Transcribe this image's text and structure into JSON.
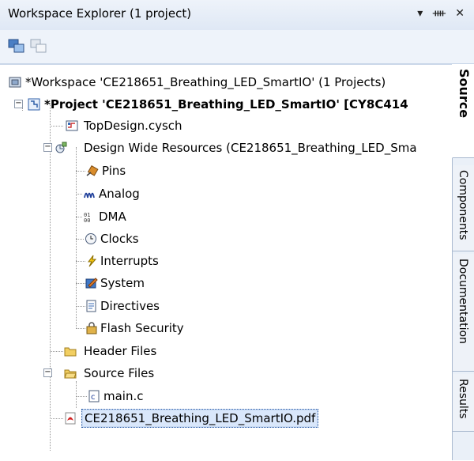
{
  "window": {
    "title": "Workspace Explorer (1 project)",
    "controls": "▾ ⊥ ✕"
  },
  "tree": {
    "workspace": "*Workspace 'CE218651_Breathing_LED_SmartIO' (1 Projects)",
    "project": "*Project  'CE218651_Breathing_LED_SmartIO' [CY8C414",
    "top_design": "TopDesign.cysch",
    "dwr": "Design Wide Resources (CE218651_Breathing_LED_Sma",
    "dwr_items": [
      "Pins",
      "Analog",
      "DMA",
      "Clocks",
      "Interrupts",
      "System",
      "Directives",
      "Flash Security"
    ],
    "header_files": "Header Files",
    "source_files": "Source Files",
    "main_c": "main.c",
    "pdf": "CE218651_Breathing_LED_SmartIO.pdf"
  },
  "tabs": [
    "Source",
    "Components",
    "Documentation",
    "Results"
  ],
  "colors": {
    "selection": "#d9e7fb",
    "titlebar": "#dfe8f5"
  }
}
